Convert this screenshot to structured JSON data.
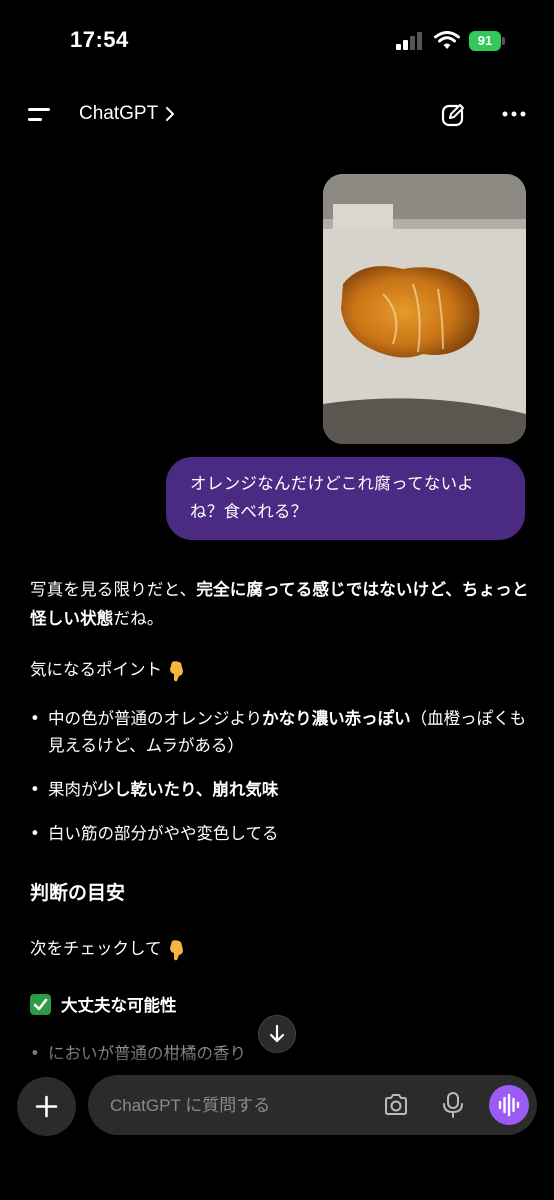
{
  "status_bar": {
    "time": "17:54",
    "battery": "91"
  },
  "header": {
    "title": "ChatGPT"
  },
  "user_message": {
    "text": "オレンジなんだけどこれ腐ってないよね？食べれる？"
  },
  "assistant": {
    "p1_a": "写真を見る限りだと、",
    "p1_b": "完全に腐ってる感じではないけど、",
    "p1_c": "ちょっと怪しい状態",
    "p1_d": "だね。",
    "points_heading": "気になるポイント",
    "bullet1_a": "中の色が普通のオレンジより",
    "bullet1_b": "かなり濃い赤っぽい",
    "bullet1_c": "（血橙っぽくも見えるけど、ムラがある）",
    "bullet2_a": "果肉が",
    "bullet2_b": "少し乾いたり、崩れ気味",
    "bullet3": "白い筋の部分がやや変色してる",
    "section_heading": "判断の目安",
    "check_intro": "次をチェックして",
    "ok_heading": "大丈夫な可能性",
    "ok_bullet1": "においが普通の柑橘の香り"
  },
  "composer": {
    "placeholder": "ChatGPT に質問する"
  },
  "colors": {
    "user_bubble": "#4a2a83",
    "voice_button": "#9b5cf5",
    "battery": "#34c759"
  }
}
